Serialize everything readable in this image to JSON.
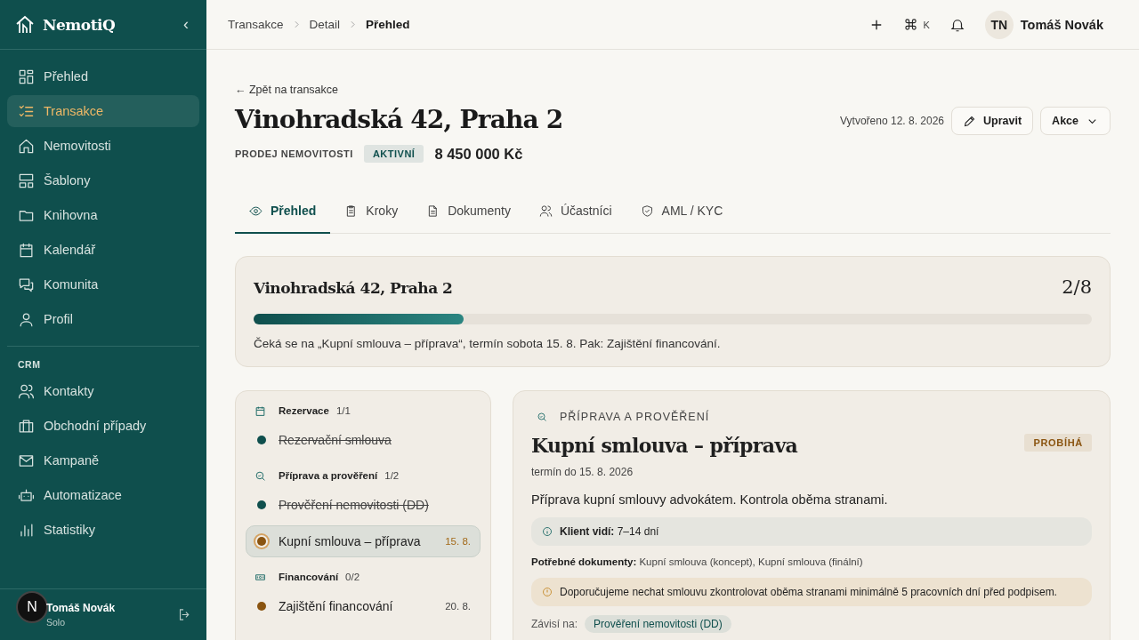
{
  "sidebar": {
    "logo": "NemotiQ",
    "collapse": "‹",
    "items": [
      {
        "label": "Přehled",
        "selected": false
      },
      {
        "label": "Transakce",
        "selected": true
      },
      {
        "label": "Nemovitosti",
        "selected": false
      },
      {
        "label": "Šablony",
        "selected": false
      },
      {
        "label": "Knihovna",
        "selected": false
      },
      {
        "label": "Kalendář",
        "selected": false
      },
      {
        "label": "Komunita",
        "selected": false
      },
      {
        "label": "Profil",
        "selected": false
      }
    ],
    "section": "CRM",
    "crm_items": [
      {
        "label": "Kontakty",
        "selected": false
      },
      {
        "label": "Obchodní případy",
        "selected": false
      },
      {
        "label": "Kampaně",
        "selected": false
      },
      {
        "label": "Automatizace",
        "selected": false
      },
      {
        "label": "Statistiky",
        "selected": false
      }
    ],
    "user": {
      "name": "Tomáš Novák",
      "plan": "Solo",
      "badge": "N"
    }
  },
  "topbar": {
    "breadcrumbs": [
      "Transakce",
      "Detail",
      "Přehled"
    ],
    "shortcut": "K",
    "avatar": "TN",
    "user": "Tomáš Novák"
  },
  "header": {
    "back": "← Zpět na transakce",
    "title": "Vinohradská 42, Praha 2",
    "type": "PRODEJ NEMOVITOSTI",
    "status": "AKTIVNÍ",
    "price": "8 450 000 Kč",
    "created": "Vytvořeno 12. 8. 2026",
    "edit": "Upravit",
    "actions": "Akce"
  },
  "tabs": [
    {
      "label": "Přehled",
      "selected": true
    },
    {
      "label": "Kroky",
      "selected": false
    },
    {
      "label": "Dokumenty",
      "selected": false
    },
    {
      "label": "Účastníci",
      "selected": false
    },
    {
      "label": "AML / KYC",
      "selected": false
    }
  ],
  "progress": {
    "title": "Vinohradská 42, Praha 2",
    "count": "2/8",
    "level": 0.25,
    "note": "Čeká se na „Kupní smlouva – příprava“, termín sobota 15. 8. Pak: Zajištění financování."
  },
  "steps": [
    {
      "title": "Rezervace",
      "count": "1/1",
      "items": [
        {
          "label": "Rezervační smlouva",
          "done": true,
          "selected": false
        }
      ]
    },
    {
      "title": "Příprava a prověření",
      "count": "1/2",
      "items": [
        {
          "label": "Prověření nemovitosti (DD)",
          "done": true,
          "selected": false
        },
        {
          "label": "Kupní smlouva – příprava",
          "done": false,
          "selected": true,
          "date": "15. 8."
        }
      ]
    },
    {
      "title": "Financování",
      "count": "0/2",
      "items": [
        {
          "label": "Zajištění financování",
          "done": false,
          "selected": false,
          "date": "20. 8."
        }
      ]
    }
  ],
  "detail": {
    "phase": "PŘÍPRAVA A PROVĚŘENÍ",
    "title": "Kupní smlouva – příprava",
    "status": "PROBÍHÁ",
    "due": "termín do 15. 8. 2026",
    "description": "Příprava kupní smlouvy advokátem. Kontrola oběma stranami.",
    "client_note": "**Klient vidí:** 7–14 dní",
    "documents": "**Potřebné dokumenty:** Kupní smlouva (koncept), Kupní smlouva (finální)",
    "warning": "Doporučujeme nechat smlouvu zkontrolovat oběma stranami minimálně 5 pracovních dní před podpisem.",
    "depends_label": "Závisí na:",
    "depends": "Prověření nemovitosti (DD)"
  }
}
